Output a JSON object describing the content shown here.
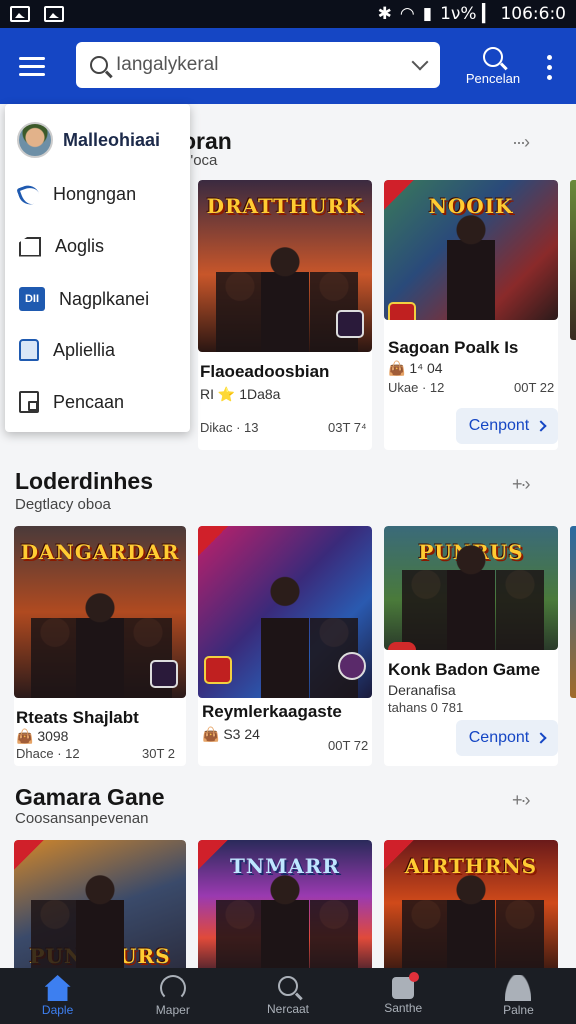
{
  "status_bar": {
    "text": "1ν% ▎ 106:6:0"
  },
  "app_bar": {
    "search_value": "Iangalykeral",
    "search_action_label": "Pencelan"
  },
  "drawer": {
    "user_name": "Malleohiaai",
    "items": [
      {
        "label": "Hongngan",
        "icon": "phone-icon"
      },
      {
        "label": "Aoglis",
        "icon": "tag-icon"
      },
      {
        "label": "Nagplkanei",
        "icon": "app-icon",
        "icon_text": "DII"
      },
      {
        "label": "Apliellia",
        "icon": "bag-icon"
      },
      {
        "label": "Pencaan",
        "icon": "box-icon"
      }
    ]
  },
  "sections": [
    {
      "title": "oran",
      "subtitle": "o'oca",
      "cards": [
        {
          "thumb_title": "DRATTHURK",
          "title": "Flaoeadoosbian",
          "sub": "RI ⭐ 1Da8a",
          "meta": "Dikac · 13",
          "count": "03T 7⁴"
        },
        {
          "thumb_title": "NOOIK",
          "title": "Sagoan Poalk Is",
          "sub": "👜 1⁴ 04",
          "meta": "Ukae · 12",
          "count": "00T 22",
          "button": "Cenpont"
        }
      ]
    },
    {
      "title": "Loderdinhes",
      "subtitle": "Degtlacy oboa",
      "cards": [
        {
          "thumb_title": "DANGARDAR",
          "title": "Rteats Shajlabt",
          "sub": "👜 3098",
          "meta": "Dhace · 12",
          "count": "30T 2"
        },
        {
          "thumb_title": "",
          "title": "Reymlerkaagaste",
          "sub": "👜 S3 24",
          "meta": "",
          "count": "00T 72"
        },
        {
          "thumb_title": "PUNRUS",
          "title": "Konk Badon Game",
          "sub": "Deranafisa",
          "meta": "tahans 0 781",
          "count": "",
          "button": "Cenpont"
        }
      ]
    },
    {
      "title": "Gamara Gane",
      "subtitle": "Coosansanpevenan",
      "cards": [
        {
          "thumb_title": "PUNTHURS"
        },
        {
          "thumb_title": "TNMARR"
        },
        {
          "thumb_title": "AIRTHRNS"
        }
      ]
    }
  ],
  "bottom_nav": [
    {
      "label": "Daple",
      "icon": "home-icon"
    },
    {
      "label": "Maper",
      "icon": "gauge-icon"
    },
    {
      "label": "Nercaat",
      "icon": "search-icon"
    },
    {
      "label": "Santhe",
      "icon": "store-icon"
    },
    {
      "label": "Palne",
      "icon": "person-icon"
    }
  ],
  "colors": {
    "app_bar": "#1546c4",
    "accent": "#3d7ff0",
    "bottom_nav": "#1b1e24"
  }
}
